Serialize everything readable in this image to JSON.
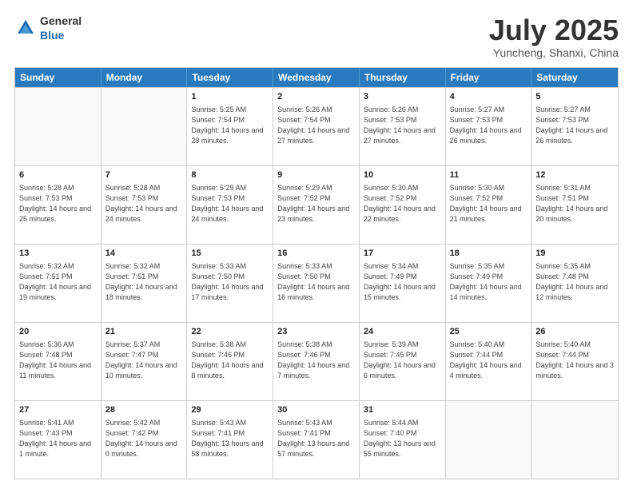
{
  "header": {
    "logo_general": "General",
    "logo_blue": "Blue",
    "month": "July 2025",
    "location": "Yuncheng, Shanxi, China"
  },
  "weekdays": [
    "Sunday",
    "Monday",
    "Tuesday",
    "Wednesday",
    "Thursday",
    "Friday",
    "Saturday"
  ],
  "weeks": [
    [
      {
        "day": "",
        "info": ""
      },
      {
        "day": "",
        "info": ""
      },
      {
        "day": "1",
        "info": "Sunrise: 5:25 AM\nSunset: 7:54 PM\nDaylight: 14 hours and 28 minutes."
      },
      {
        "day": "2",
        "info": "Sunrise: 5:26 AM\nSunset: 7:54 PM\nDaylight: 14 hours and 27 minutes."
      },
      {
        "day": "3",
        "info": "Sunrise: 5:26 AM\nSunset: 7:53 PM\nDaylight: 14 hours and 27 minutes."
      },
      {
        "day": "4",
        "info": "Sunrise: 5:27 AM\nSunset: 7:53 PM\nDaylight: 14 hours and 26 minutes."
      },
      {
        "day": "5",
        "info": "Sunrise: 5:27 AM\nSunset: 7:53 PM\nDaylight: 14 hours and 26 minutes."
      }
    ],
    [
      {
        "day": "6",
        "info": "Sunrise: 5:28 AM\nSunset: 7:53 PM\nDaylight: 14 hours and 25 minutes."
      },
      {
        "day": "7",
        "info": "Sunrise: 5:28 AM\nSunset: 7:53 PM\nDaylight: 14 hours and 24 minutes."
      },
      {
        "day": "8",
        "info": "Sunrise: 5:29 AM\nSunset: 7:53 PM\nDaylight: 14 hours and 24 minutes."
      },
      {
        "day": "9",
        "info": "Sunrise: 5:29 AM\nSunset: 7:52 PM\nDaylight: 14 hours and 23 minutes."
      },
      {
        "day": "10",
        "info": "Sunrise: 5:30 AM\nSunset: 7:52 PM\nDaylight: 14 hours and 22 minutes."
      },
      {
        "day": "11",
        "info": "Sunrise: 5:30 AM\nSunset: 7:52 PM\nDaylight: 14 hours and 21 minutes."
      },
      {
        "day": "12",
        "info": "Sunrise: 5:31 AM\nSunset: 7:51 PM\nDaylight: 14 hours and 20 minutes."
      }
    ],
    [
      {
        "day": "13",
        "info": "Sunrise: 5:32 AM\nSunset: 7:51 PM\nDaylight: 14 hours and 19 minutes."
      },
      {
        "day": "14",
        "info": "Sunrise: 5:32 AM\nSunset: 7:51 PM\nDaylight: 14 hours and 18 minutes."
      },
      {
        "day": "15",
        "info": "Sunrise: 5:33 AM\nSunset: 7:50 PM\nDaylight: 14 hours and 17 minutes."
      },
      {
        "day": "16",
        "info": "Sunrise: 5:33 AM\nSunset: 7:50 PM\nDaylight: 14 hours and 16 minutes."
      },
      {
        "day": "17",
        "info": "Sunrise: 5:34 AM\nSunset: 7:49 PM\nDaylight: 14 hours and 15 minutes."
      },
      {
        "day": "18",
        "info": "Sunrise: 5:35 AM\nSunset: 7:49 PM\nDaylight: 14 hours and 14 minutes."
      },
      {
        "day": "19",
        "info": "Sunrise: 5:35 AM\nSunset: 7:48 PM\nDaylight: 14 hours and 12 minutes."
      }
    ],
    [
      {
        "day": "20",
        "info": "Sunrise: 5:36 AM\nSunset: 7:48 PM\nDaylight: 14 hours and 11 minutes."
      },
      {
        "day": "21",
        "info": "Sunrise: 5:37 AM\nSunset: 7:47 PM\nDaylight: 14 hours and 10 minutes."
      },
      {
        "day": "22",
        "info": "Sunrise: 5:38 AM\nSunset: 7:46 PM\nDaylight: 14 hours and 8 minutes."
      },
      {
        "day": "23",
        "info": "Sunrise: 5:38 AM\nSunset: 7:46 PM\nDaylight: 14 hours and 7 minutes."
      },
      {
        "day": "24",
        "info": "Sunrise: 5:39 AM\nSunset: 7:45 PM\nDaylight: 14 hours and 6 minutes."
      },
      {
        "day": "25",
        "info": "Sunrise: 5:40 AM\nSunset: 7:44 PM\nDaylight: 14 hours and 4 minutes."
      },
      {
        "day": "26",
        "info": "Sunrise: 5:40 AM\nSunset: 7:44 PM\nDaylight: 14 hours and 3 minutes."
      }
    ],
    [
      {
        "day": "27",
        "info": "Sunrise: 5:41 AM\nSunset: 7:43 PM\nDaylight: 14 hours and 1 minute."
      },
      {
        "day": "28",
        "info": "Sunrise: 5:42 AM\nSunset: 7:42 PM\nDaylight: 14 hours and 0 minutes."
      },
      {
        "day": "29",
        "info": "Sunrise: 5:43 AM\nSunset: 7:41 PM\nDaylight: 13 hours and 58 minutes."
      },
      {
        "day": "30",
        "info": "Sunrise: 5:43 AM\nSunset: 7:41 PM\nDaylight: 13 hours and 57 minutes."
      },
      {
        "day": "31",
        "info": "Sunrise: 5:44 AM\nSunset: 7:40 PM\nDaylight: 13 hours and 55 minutes."
      },
      {
        "day": "",
        "info": ""
      },
      {
        "day": "",
        "info": ""
      }
    ]
  ]
}
